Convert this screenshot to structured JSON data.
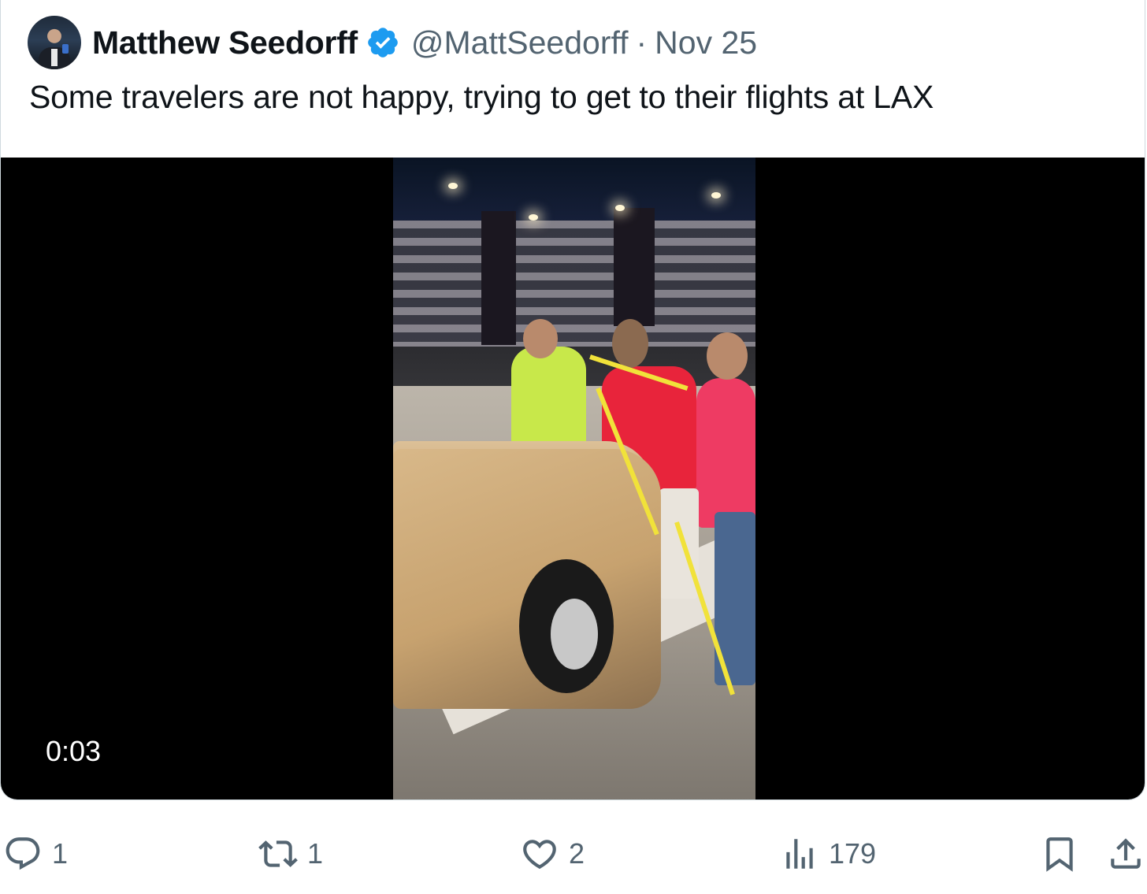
{
  "tweet": {
    "author": {
      "display_name": "Matthew Seedorff",
      "handle": "@MattSeedorff",
      "verified": true,
      "verified_color": "#1d9bf0"
    },
    "separator": "·",
    "date": "Nov 25",
    "text": "Some travelers are not happy, trying to get to their flights at LAX",
    "media": {
      "type": "video",
      "timestamp": "0:03"
    },
    "actions": {
      "reply": {
        "icon": "reply-icon",
        "count": "1"
      },
      "retweet": {
        "icon": "retweet-icon",
        "count": "1"
      },
      "like": {
        "icon": "heart-icon",
        "count": "2"
      },
      "views": {
        "icon": "views-icon",
        "count": "179"
      },
      "bookmark": {
        "icon": "bookmark-icon"
      },
      "share": {
        "icon": "share-icon"
      }
    }
  },
  "colors": {
    "text_primary": "#0f1419",
    "text_secondary": "#536471",
    "border": "#cfd9de",
    "media_background": "#000000"
  }
}
